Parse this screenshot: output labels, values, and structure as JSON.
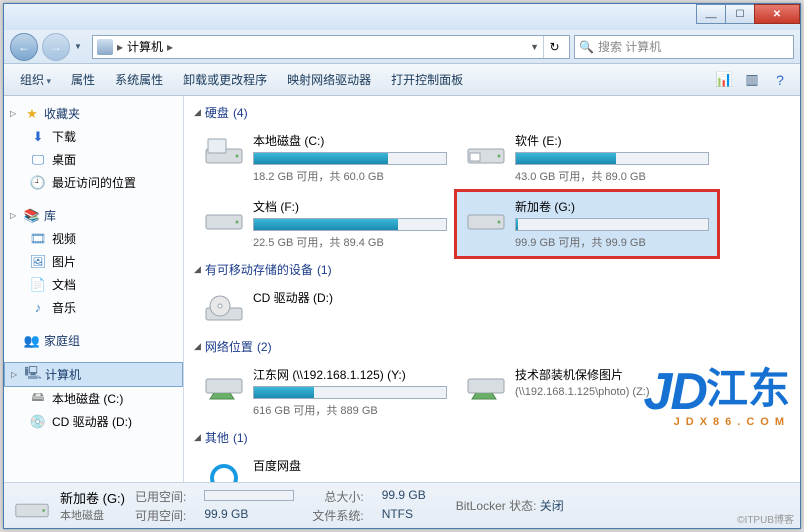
{
  "window": {
    "address_label": "计算机",
    "address_sep": "▸",
    "search_placeholder": "搜索 计算机"
  },
  "toolbar": {
    "organize": "组织",
    "properties": "属性",
    "sys_properties": "系统属性",
    "uninstall": "卸载或更改程序",
    "map_drive": "映射网络驱动器",
    "control_panel": "打开控制面板"
  },
  "sidebar": {
    "favorites": "收藏夹",
    "downloads": "下载",
    "desktop": "桌面",
    "recent": "最近访问的位置",
    "libraries": "库",
    "videos": "视频",
    "pictures": "图片",
    "documents": "文档",
    "music": "音乐",
    "homegroup": "家庭组",
    "computer": "计算机",
    "drive_c": "本地磁盘 (C:)",
    "drive_d": "CD 驱动器 (D:)"
  },
  "sections": {
    "hdd": {
      "label": "硬盘",
      "count": "(4)"
    },
    "removable": {
      "label": "有可移动存储的设备",
      "count": "(1)"
    },
    "network": {
      "label": "网络位置",
      "count": "(2)"
    },
    "other": {
      "label": "其他",
      "count": "(1)"
    }
  },
  "drives": {
    "c": {
      "name": "本地磁盘 (C:)",
      "stat": "18.2 GB 可用，共 60.0 GB",
      "fill": 70
    },
    "e": {
      "name": "软件 (E:)",
      "stat": "43.0 GB 可用，共 89.0 GB",
      "fill": 52
    },
    "f": {
      "name": "文档 (F:)",
      "stat": "22.5 GB 可用，共 89.4 GB",
      "fill": 75
    },
    "g": {
      "name": "新加卷 (G:)",
      "stat": "99.9 GB 可用，共 99.9 GB",
      "fill": 1
    },
    "cd": {
      "name": "CD 驱动器 (D:)"
    },
    "y": {
      "name": "江东网 (\\\\192.168.1.125) (Y:)",
      "stat": "616 GB 可用，共 889 GB",
      "fill": 31
    },
    "z": {
      "name": "技术部装机保修图片",
      "path": "(\\\\192.168.1.125\\photo) (Z:)"
    },
    "baidu": {
      "name": "百度网盘"
    }
  },
  "status": {
    "title": "新加卷 (G:)",
    "subtitle": "本地磁盘",
    "used_label": "已用空间:",
    "total_label": "总大小:",
    "total_val": "99.9 GB",
    "free_label": "可用空间:",
    "free_val": "99.9 GB",
    "fs_label": "文件系统:",
    "fs_val": "NTFS",
    "bitlocker_label": "BitLocker 状态:",
    "bitlocker_val": "关闭"
  },
  "watermark": {
    "brand": "JD",
    "cn": "江东",
    "url": "JDX86.COM"
  },
  "attrib": "©ITPUB博客"
}
